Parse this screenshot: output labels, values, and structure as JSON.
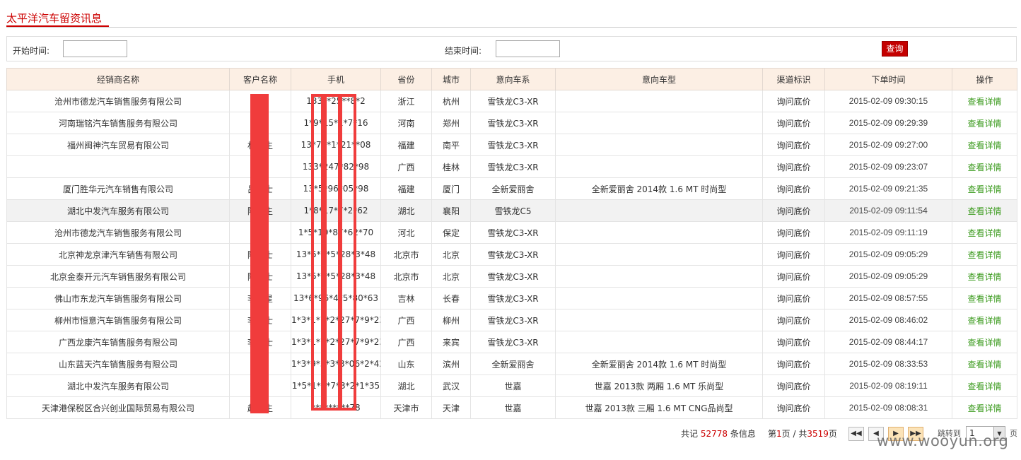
{
  "page": {
    "title": "太平洋汽车留资讯息"
  },
  "filter": {
    "start_label": "开始时间:",
    "start_value": "",
    "end_label": "结束时间:",
    "end_value": "",
    "query_label": "查询"
  },
  "table": {
    "columns": [
      "经销商名称",
      "客户名称",
      "手机",
      "省份",
      "城市",
      "意向车系",
      "意向车型",
      "渠道标识",
      "下单时间",
      "操作"
    ],
    "rows": [
      {
        "dealer": "沧州市德龙汽车销售服务有限公司",
        "customer": "",
        "phone": "133**25**8*2",
        "province": "浙江",
        "city": "杭州",
        "series": "雪铁龙C3-XR",
        "model": "",
        "channel": "询问底价",
        "time": "2015-02-09 09:30:15",
        "action": "查看详情"
      },
      {
        "dealer": "河南瑞铭汽车销售服务有限公司",
        "customer": "",
        "phone": "1*9*15*1*7*16",
        "province": "河南",
        "city": "郑州",
        "series": "雪铁龙C3-XR",
        "model": "",
        "channel": "询问底价",
        "time": "2015-02-09 09:29:39",
        "action": "查看详情"
      },
      {
        "dealer": "福州闽神汽车贸易有限公司",
        "customer": "林**生",
        "phone": "13*79*1*21**08",
        "province": "福建",
        "city": "南平",
        "series": "雪铁龙C3-XR",
        "model": "",
        "channel": "询问底价",
        "time": "2015-02-09 09:27:00",
        "action": "查看详情"
      },
      {
        "dealer": "",
        "customer": "**彬",
        "phone": "133*247*82*98",
        "province": "广西",
        "city": "桂林",
        "series": "雪铁龙C3-XR",
        "model": "",
        "channel": "询问底价",
        "time": "2015-02-09 09:23:07",
        "action": "查看详情"
      },
      {
        "dealer": "厦门胜华元汽车销售有限公司",
        "customer": "吕**士",
        "phone": "13*5*96*05*98",
        "province": "福建",
        "city": "厦门",
        "series": "全新爱丽舍",
        "model": "全新爱丽舍 2014款 1.6 MT 时尚型",
        "channel": "询问底价",
        "time": "2015-02-09 09:21:35",
        "action": "查看详情"
      },
      {
        "dealer": "湖北中发汽车服务有限公司",
        "customer": "陈**生",
        "phone": "1*8*17*7*2*62",
        "province": "湖北",
        "city": "襄阳",
        "series": "雪铁龙C5",
        "model": "",
        "channel": "询问底价",
        "time": "2015-02-09 09:11:54",
        "action": "查看详情"
      },
      {
        "dealer": "沧州市德龙汽车销售服务有限公司",
        "customer": "",
        "phone": "1*5*19*87*62*70",
        "province": "河北",
        "city": "保定",
        "series": "雪铁龙C3-XR",
        "model": "",
        "channel": "询问底价",
        "time": "2015-02-09 09:11:19",
        "action": "查看详情"
      },
      {
        "dealer": "北京神龙京津汽车销售有限公司",
        "customer": "陈**士",
        "phone": "13*5*2*5*28*3*48",
        "province": "北京市",
        "city": "北京",
        "series": "雪铁龙C3-XR",
        "model": "",
        "channel": "询问底价",
        "time": "2015-02-09 09:05:29",
        "action": "查看详情"
      },
      {
        "dealer": "北京金泰开元汽车销售服务有限公司",
        "customer": "陈**士",
        "phone": "13*5*2*5*28*3*48",
        "province": "北京市",
        "city": "北京",
        "series": "雪铁龙C3-XR",
        "model": "",
        "channel": "询问底价",
        "time": "2015-02-09 09:05:29",
        "action": "查看详情"
      },
      {
        "dealer": "佛山市东龙汽车销售服务有限公司",
        "customer": "李**星",
        "phone": "13*6*96*4*5*80*63",
        "province": "吉林",
        "city": "长春",
        "series": "雪铁龙C3-XR",
        "model": "",
        "channel": "询问底价",
        "time": "2015-02-09 08:57:55",
        "action": "查看详情"
      },
      {
        "dealer": "柳州市恒意汽车销售服务有限公司",
        "customer": "李**士",
        "phone": "1*3*1*7*2*27*7*9*23",
        "province": "广西",
        "city": "柳州",
        "series": "雪铁龙C3-XR",
        "model": "",
        "channel": "询问底价",
        "time": "2015-02-09 08:46:02",
        "action": "查看详情"
      },
      {
        "dealer": "广西龙康汽车销售服务有限公司",
        "customer": "李**士",
        "phone": "1*3*1*7*2*27*7*9*23",
        "province": "广西",
        "city": "来宾",
        "series": "雪铁龙C3-XR",
        "model": "",
        "channel": "询问底价",
        "time": "2015-02-09 08:44:17",
        "action": "查看详情"
      },
      {
        "dealer": "山东蓝天汽车销售服务有限公司",
        "customer": "",
        "phone": "1*3*9*5*3*3*06*2*42",
        "province": "山东",
        "city": "滨州",
        "series": "全新爱丽舍",
        "model": "全新爱丽舍 2014款 1.6 MT 时尚型",
        "channel": "询问底价",
        "time": "2015-02-09 08:33:53",
        "action": "查看详情"
      },
      {
        "dealer": "湖北中发汽车服务有限公司",
        "customer": "",
        "phone": "1*5*1*2*7*3*2*1*35",
        "province": "湖北",
        "city": "武汉",
        "series": "世嘉",
        "model": "世嘉 2013款 两厢 1.6 MT 乐尚型",
        "channel": "询问底价",
        "time": "2015-02-09 08:19:11",
        "action": "查看详情"
      },
      {
        "dealer": "天津港保税区合兴创业国际贸易有限公司",
        "customer": "赵**生",
        "phone": "*********78",
        "province": "天津市",
        "city": "天津",
        "series": "世嘉",
        "model": "世嘉 2013款 三厢 1.6 MT CNG品尚型",
        "channel": "询问底价",
        "time": "2015-02-09 08:08:31",
        "action": "查看详情"
      }
    ]
  },
  "pager": {
    "total_prefix": "共记",
    "total_count": "52778",
    "total_suffix": "条信息",
    "page_prefix": "第",
    "current_page": "1",
    "page_mid": "页 / 共",
    "total_pages": "3519",
    "page_suffix": "页",
    "first_icon": "first-page-icon",
    "prev_icon": "prev-page-icon",
    "next_icon": "next-page-icon",
    "last_icon": "last-page-icon",
    "jump_label": "跳转到",
    "jump_value": "1",
    "jump_unit": "页"
  },
  "watermark": "www.wooyun.org",
  "colors": {
    "accent": "#cc0000",
    "header_bg": "#fcefe4",
    "link": "#3a9a1c",
    "redaction": "#f03c3c"
  }
}
